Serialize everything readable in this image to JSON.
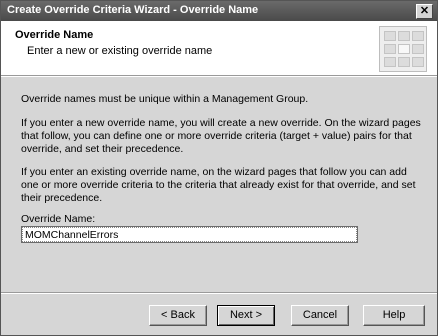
{
  "window": {
    "title": "Create Override Criteria Wizard - Override Name",
    "close_glyph": "✕"
  },
  "header": {
    "title": "Override Name",
    "subtitle": "Enter a new or existing override name"
  },
  "content": {
    "paragraphs": [
      "Override names must be unique within a Management Group.",
      "If you enter a new override name, you will create a new override. On the wizard pages that follow, you can define one or more override criteria (target + value) pairs for that override, and set their precedence.",
      "If you enter an existing override name, on the wizard pages that follow you can add one or more override criteria to the criteria that already exist for that override, and set their precedence."
    ],
    "field_label": "Override Name:",
    "field_value": "MOMChannelErrors"
  },
  "buttons": {
    "back": "< Back",
    "next": "Next >",
    "cancel": "Cancel",
    "help": "Help"
  },
  "colors": {
    "title_bar": "#4a4a4a",
    "dialog_bg": "#d6d6d6",
    "header_bg": "#ffffff"
  },
  "icons": {
    "header_graphic": "wizard-grid-icon",
    "close": "close-icon"
  }
}
